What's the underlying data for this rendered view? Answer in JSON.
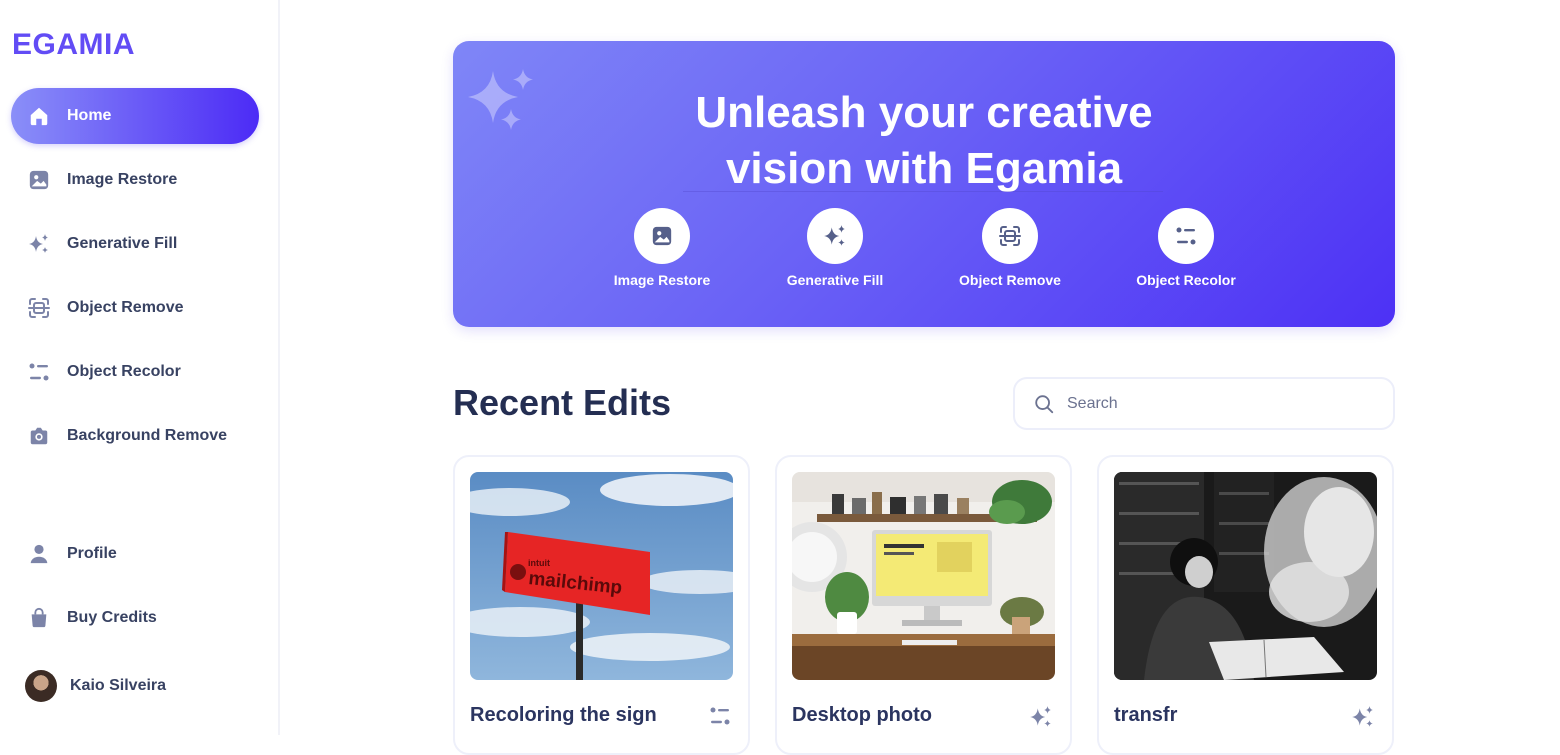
{
  "brand": {
    "name": "EGAMIA",
    "color": "#624cf5"
  },
  "sidebar": {
    "items": [
      {
        "label": "Home",
        "icon": "home-icon",
        "active": true
      },
      {
        "label": "Image Restore",
        "icon": "image-icon"
      },
      {
        "label": "Generative Fill",
        "icon": "sparkles-icon"
      },
      {
        "label": "Object Remove",
        "icon": "scan-icon"
      },
      {
        "label": "Object Recolor",
        "icon": "filters-icon"
      },
      {
        "label": "Background Remove",
        "icon": "camera-icon"
      }
    ],
    "bottom": [
      {
        "label": "Profile",
        "icon": "user-icon"
      },
      {
        "label": "Buy Credits",
        "icon": "bag-icon"
      }
    ],
    "user": {
      "name": "Kaio Silveira"
    }
  },
  "hero": {
    "title_line1": "Unleash your creative",
    "title_line2": "vision with Egamia",
    "tools": [
      {
        "label": "Image Restore",
        "icon": "image-icon"
      },
      {
        "label": "Generative Fill",
        "icon": "sparkles-icon"
      },
      {
        "label": "Object Remove",
        "icon": "scan-icon"
      },
      {
        "label": "Object Recolor",
        "icon": "filters-icon"
      }
    ]
  },
  "recent": {
    "title": "Recent Edits",
    "search_placeholder": "Search",
    "cards": [
      {
        "title": "Recoloring the sign",
        "icon": "filters-icon",
        "sign_small": "intuit",
        "sign_big": "mailchimp"
      },
      {
        "title": "Desktop photo",
        "icon": "sparkles-icon"
      },
      {
        "title": "transfr",
        "icon": "sparkles-icon"
      }
    ]
  }
}
